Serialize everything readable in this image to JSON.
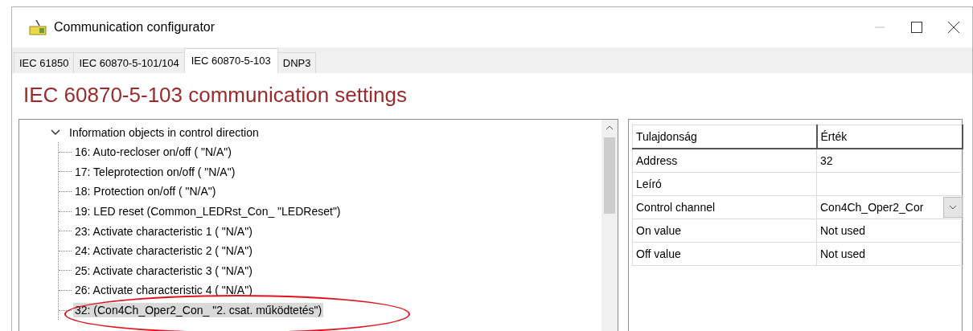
{
  "window": {
    "title": "Communication configurator"
  },
  "tabs": [
    {
      "label": "IEC 61850",
      "selected": false
    },
    {
      "label": "IEC 60870-5-101/104",
      "selected": false
    },
    {
      "label": "IEC 60870-5-103",
      "selected": true
    },
    {
      "label": "DNP3",
      "selected": false
    }
  ],
  "heading": "IEC 60870-5-103 communication settings",
  "tree": {
    "label": "Information objects in control direction",
    "expanded": true,
    "children": [
      {
        "label": "16: Auto-recloser on/off ( \"N/A\")",
        "selected": false
      },
      {
        "label": "17: Teleprotection on/off ( \"N/A\")",
        "selected": false
      },
      {
        "label": "18: Protection on/off ( \"N/A\")",
        "selected": false
      },
      {
        "label": "19: LED reset (Common_LEDRst_Con_ \"LEDReset\")",
        "selected": false
      },
      {
        "label": "23: Activate characteristic 1 ( \"N/A\")",
        "selected": false
      },
      {
        "label": "24: Activate characteristic 2 ( \"N/A\")",
        "selected": false
      },
      {
        "label": "25: Activate characteristic 3 ( \"N/A\")",
        "selected": false
      },
      {
        "label": "26: Activate characteristic 4 ( \"N/A\")",
        "selected": false
      },
      {
        "label": "32:  (Con4Ch_Oper2_Con_ \"2. csat. működtetés\")",
        "selected": true
      }
    ]
  },
  "properties": {
    "columns": [
      "Tulajdonság",
      "Érték"
    ],
    "rows": [
      {
        "name": "Address",
        "value": "32",
        "kind": "text"
      },
      {
        "name": "Leíró",
        "value": "",
        "kind": "text"
      },
      {
        "name": "Control channel",
        "value": "Con4Ch_Oper2_Cor",
        "kind": "dropdown"
      },
      {
        "name": "On value",
        "value": "Not used",
        "kind": "text"
      },
      {
        "name": "Off value",
        "value": "Not used",
        "kind": "text"
      }
    ]
  }
}
